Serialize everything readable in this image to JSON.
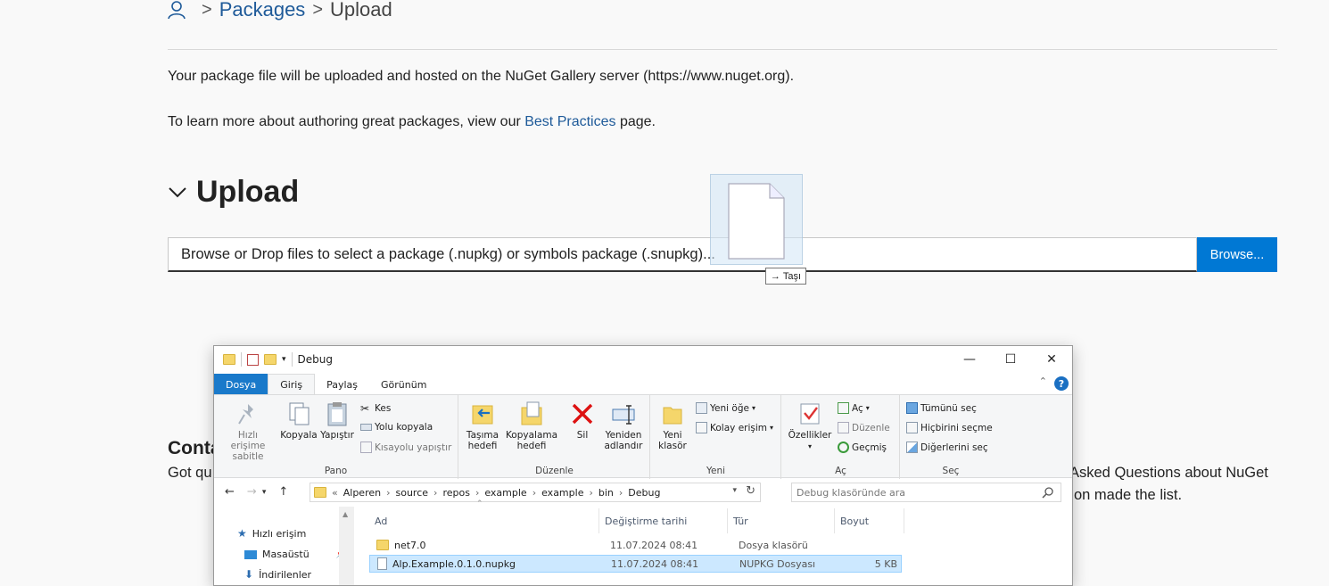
{
  "breadcrumb": {
    "packages": "Packages",
    "upload": "Upload"
  },
  "intro": {
    "line1": "Your package file will be uploaded and hosted on the NuGet Gallery server (https://www.nuget.org).",
    "line2_before": "To learn more about authoring great packages, view our ",
    "line2_link": "Best Practices",
    "line2_after": " page."
  },
  "upload": {
    "heading": "Upload",
    "drop_placeholder": "Browse or Drop files to select a package (.nupkg) or symbols package (.snupkg)...",
    "browse_label": "Browse..."
  },
  "drag": {
    "tooltip": "Taşı"
  },
  "contact": {
    "heading_partial": "Conta",
    "text_partial": "Got qu",
    "faq_line1": "Asked Questions about NuGet",
    "faq_line2": "on made the list."
  },
  "explorer": {
    "title": "Debug",
    "tabs": [
      "Dosya",
      "Giriş",
      "Paylaş",
      "Görünüm"
    ],
    "ribbon": {
      "pano": {
        "label": "Pano",
        "pin": "Hızlı erişime\nsabitle",
        "copy": "Kopyala",
        "paste": "Yapıştır",
        "cut": "Kes",
        "copy_path": "Yolu kopyala",
        "paste_shortcut": "Kısayolu yapıştır"
      },
      "duzenle": {
        "label": "Düzenle",
        "move_to": "Taşıma\nhedefi",
        "copy_to": "Kopyalama\nhedefi",
        "delete": "Sil",
        "rename": "Yeniden\nadlandır"
      },
      "yeni": {
        "label": "Yeni",
        "new_folder": "Yeni\nklasör",
        "new_item": "Yeni öğe",
        "easy_access": "Kolay erişim"
      },
      "ac": {
        "label": "Aç",
        "properties": "Özellikler",
        "open": "Aç",
        "edit": "Düzenle",
        "history": "Geçmiş"
      },
      "sec": {
        "label": "Seç",
        "select_all": "Tümünü seç",
        "select_none": "Hiçbirini seçme",
        "invert": "Diğerlerini seç"
      }
    },
    "address": {
      "prefix": "«",
      "parts": [
        "Alperen",
        "source",
        "repos",
        "example",
        "example",
        "bin",
        "Debug"
      ],
      "search_placeholder": "Debug klasöründe ara"
    },
    "nav": [
      "Hızlı erişim",
      "Masaüstü",
      "İndirilenler"
    ],
    "columns": [
      "Ad",
      "Değiştirme tarihi",
      "Tür",
      "Boyut"
    ],
    "files": [
      {
        "name": "net7.0",
        "date": "11.07.2024 08:41",
        "type": "Dosya klasörü",
        "size": ""
      },
      {
        "name": "Alp.Example.0.1.0.nupkg",
        "date": "11.07.2024 08:41",
        "type": "NUPKG Dosyası",
        "size": "5 KB"
      }
    ]
  }
}
